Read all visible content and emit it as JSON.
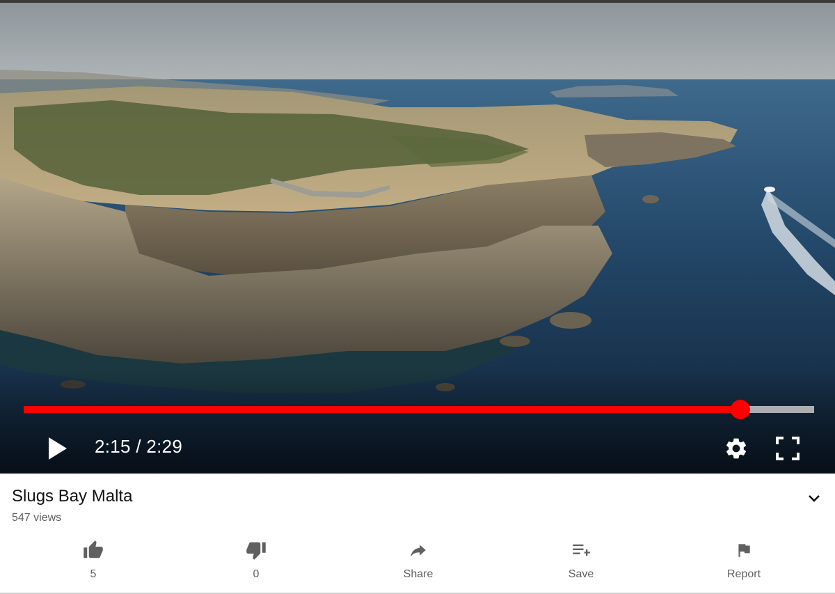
{
  "player": {
    "current_time": "2:15",
    "separator": " / ",
    "duration": "2:29",
    "progress_fraction": 0.907
  },
  "video": {
    "title": "Slugs Bay Malta",
    "views": "547 views"
  },
  "actions": {
    "like_count": "5",
    "dislike_count": "0",
    "share_label": "Share",
    "save_label": "Save",
    "report_label": "Report"
  },
  "colors": {
    "progress_red": "#ff0000",
    "text_secondary": "#606060",
    "icon_gray": "#606060"
  },
  "icons": [
    "play-icon",
    "gear-icon",
    "fullscreen-icon",
    "chevron-down-icon",
    "thumb-up-icon",
    "thumb-down-icon",
    "share-icon",
    "save-to-playlist-icon",
    "flag-icon"
  ]
}
